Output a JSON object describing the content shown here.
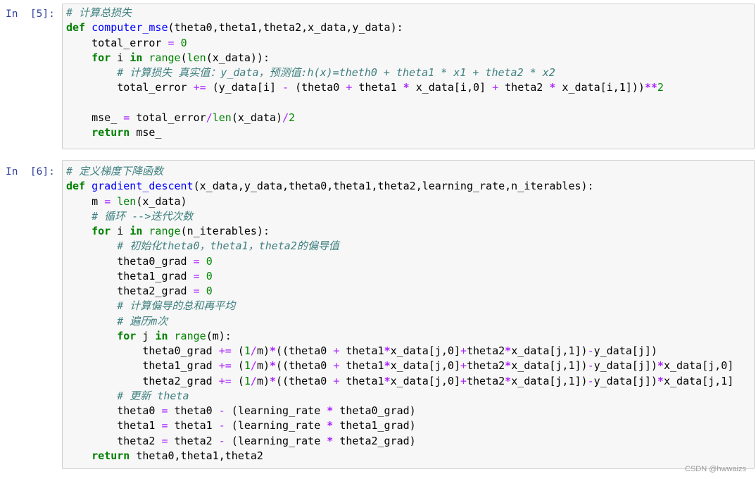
{
  "cells": [
    {
      "prompt": "In  [5]:",
      "lines": [
        [
          [
            "cm",
            "# 计算总损失"
          ]
        ],
        [
          [
            "kw",
            "def"
          ],
          [
            "t",
            " "
          ],
          [
            "fn",
            "computer_mse"
          ],
          [
            "t",
            "(theta0,theta1,theta2,x_data,y_data):"
          ]
        ],
        [
          [
            "t",
            "    total_error "
          ],
          [
            "opn",
            "="
          ],
          [
            "t",
            " "
          ],
          [
            "num",
            "0"
          ]
        ],
        [
          [
            "t",
            "    "
          ],
          [
            "kw",
            "for"
          ],
          [
            "t",
            " i "
          ],
          [
            "kw",
            "in"
          ],
          [
            "t",
            " "
          ],
          [
            "bi",
            "range"
          ],
          [
            "t",
            "("
          ],
          [
            "bi",
            "len"
          ],
          [
            "t",
            "(x_data)):"
          ]
        ],
        [
          [
            "t",
            "        "
          ],
          [
            "cm",
            "# 计算损失 真实值：y_data，预测值:h(x)=theth0 + theta1 * x1 + theta2 * x2"
          ]
        ],
        [
          [
            "t",
            "        total_error "
          ],
          [
            "opn",
            "+="
          ],
          [
            "t",
            " (y_data[i] "
          ],
          [
            "opn",
            "-"
          ],
          [
            "t",
            " (theta0 "
          ],
          [
            "opn",
            "+"
          ],
          [
            "t",
            " theta1 "
          ],
          [
            "op",
            "*"
          ],
          [
            "t",
            " x_data[i,0] "
          ],
          [
            "opn",
            "+"
          ],
          [
            "t",
            " theta2 "
          ],
          [
            "op",
            "*"
          ],
          [
            "t",
            " x_data[i,1]))"
          ],
          [
            "op",
            "**"
          ],
          [
            "num",
            "2"
          ]
        ],
        [
          [
            "t",
            ""
          ]
        ],
        [
          [
            "t",
            "    mse_ "
          ],
          [
            "opn",
            "="
          ],
          [
            "t",
            " total_error"
          ],
          [
            "opn",
            "/"
          ],
          [
            "bi",
            "len"
          ],
          [
            "t",
            "(x_data)"
          ],
          [
            "opn",
            "/"
          ],
          [
            "num",
            "2"
          ]
        ],
        [
          [
            "t",
            "    "
          ],
          [
            "kw",
            "return"
          ],
          [
            "t",
            " mse_"
          ]
        ]
      ]
    },
    {
      "prompt": "In  [6]:",
      "lines": [
        [
          [
            "cm",
            "# 定义梯度下降函数"
          ]
        ],
        [
          [
            "kw",
            "def"
          ],
          [
            "t",
            " "
          ],
          [
            "fn",
            "gradient_descent"
          ],
          [
            "t",
            "(x_data,y_data,theta0,theta1,theta2,learning_rate,n_iterables):"
          ]
        ],
        [
          [
            "t",
            "    m "
          ],
          [
            "opn",
            "="
          ],
          [
            "t",
            " "
          ],
          [
            "bi",
            "len"
          ],
          [
            "t",
            "(x_data)"
          ]
        ],
        [
          [
            "t",
            "    "
          ],
          [
            "cm",
            "# 循环 -->迭代次数"
          ]
        ],
        [
          [
            "t",
            "    "
          ],
          [
            "kw",
            "for"
          ],
          [
            "t",
            " i "
          ],
          [
            "kw",
            "in"
          ],
          [
            "t",
            " "
          ],
          [
            "bi",
            "range"
          ],
          [
            "t",
            "(n_iterables):"
          ]
        ],
        [
          [
            "t",
            "        "
          ],
          [
            "cm",
            "# 初始化theta0，theta1，theta2的偏导值"
          ]
        ],
        [
          [
            "t",
            "        theta0_grad "
          ],
          [
            "opn",
            "="
          ],
          [
            "t",
            " "
          ],
          [
            "num",
            "0"
          ]
        ],
        [
          [
            "t",
            "        theta1_grad "
          ],
          [
            "opn",
            "="
          ],
          [
            "t",
            " "
          ],
          [
            "num",
            "0"
          ]
        ],
        [
          [
            "t",
            "        theta2_grad "
          ],
          [
            "opn",
            "="
          ],
          [
            "t",
            " "
          ],
          [
            "num",
            "0"
          ]
        ],
        [
          [
            "t",
            "        "
          ],
          [
            "cm",
            "# 计算偏导的总和再平均"
          ]
        ],
        [
          [
            "t",
            "        "
          ],
          [
            "cm",
            "# 遍历m次"
          ]
        ],
        [
          [
            "t",
            "        "
          ],
          [
            "kw",
            "for"
          ],
          [
            "t",
            " j "
          ],
          [
            "kw",
            "in"
          ],
          [
            "t",
            " "
          ],
          [
            "bi",
            "range"
          ],
          [
            "t",
            "(m):"
          ]
        ],
        [
          [
            "t",
            "            theta0_grad "
          ],
          [
            "opn",
            "+="
          ],
          [
            "t",
            " ("
          ],
          [
            "num",
            "1"
          ],
          [
            "opn",
            "/"
          ],
          [
            "t",
            "m)"
          ],
          [
            "op",
            "*"
          ],
          [
            "t",
            "((theta0 "
          ],
          [
            "opn",
            "+"
          ],
          [
            "t",
            " theta1"
          ],
          [
            "op",
            "*"
          ],
          [
            "t",
            "x_data[j,0]"
          ],
          [
            "opn",
            "+"
          ],
          [
            "t",
            "theta2"
          ],
          [
            "op",
            "*"
          ],
          [
            "t",
            "x_data[j,1])"
          ],
          [
            "opn",
            "-"
          ],
          [
            "t",
            "y_data[j])"
          ]
        ],
        [
          [
            "t",
            "            theta1_grad "
          ],
          [
            "opn",
            "+="
          ],
          [
            "t",
            " ("
          ],
          [
            "num",
            "1"
          ],
          [
            "opn",
            "/"
          ],
          [
            "t",
            "m)"
          ],
          [
            "op",
            "*"
          ],
          [
            "t",
            "((theta0 "
          ],
          [
            "opn",
            "+"
          ],
          [
            "t",
            " theta1"
          ],
          [
            "op",
            "*"
          ],
          [
            "t",
            "x_data[j,0]"
          ],
          [
            "opn",
            "+"
          ],
          [
            "t",
            "theta2"
          ],
          [
            "op",
            "*"
          ],
          [
            "t",
            "x_data[j,1])"
          ],
          [
            "opn",
            "-"
          ],
          [
            "t",
            "y_data[j])"
          ],
          [
            "op",
            "*"
          ],
          [
            "t",
            "x_data[j,0]"
          ]
        ],
        [
          [
            "t",
            "            theta2_grad "
          ],
          [
            "opn",
            "+="
          ],
          [
            "t",
            " ("
          ],
          [
            "num",
            "1"
          ],
          [
            "opn",
            "/"
          ],
          [
            "t",
            "m)"
          ],
          [
            "op",
            "*"
          ],
          [
            "t",
            "((theta0 "
          ],
          [
            "opn",
            "+"
          ],
          [
            "t",
            " theta1"
          ],
          [
            "op",
            "*"
          ],
          [
            "t",
            "x_data[j,0]"
          ],
          [
            "opn",
            "+"
          ],
          [
            "t",
            "theta2"
          ],
          [
            "op",
            "*"
          ],
          [
            "t",
            "x_data[j,1])"
          ],
          [
            "opn",
            "-"
          ],
          [
            "t",
            "y_data[j])"
          ],
          [
            "op",
            "*"
          ],
          [
            "t",
            "x_data[j,1]"
          ]
        ],
        [
          [
            "t",
            "        "
          ],
          [
            "cm",
            "# 更新 theta"
          ]
        ],
        [
          [
            "t",
            "        theta0 "
          ],
          [
            "opn",
            "="
          ],
          [
            "t",
            " theta0 "
          ],
          [
            "opn",
            "-"
          ],
          [
            "t",
            " (learning_rate "
          ],
          [
            "op",
            "*"
          ],
          [
            "t",
            " theta0_grad)"
          ]
        ],
        [
          [
            "t",
            "        theta1 "
          ],
          [
            "opn",
            "="
          ],
          [
            "t",
            " theta1 "
          ],
          [
            "opn",
            "-"
          ],
          [
            "t",
            " (learning_rate "
          ],
          [
            "op",
            "*"
          ],
          [
            "t",
            " theta1_grad)"
          ]
        ],
        [
          [
            "t",
            "        theta2 "
          ],
          [
            "opn",
            "="
          ],
          [
            "t",
            " theta2 "
          ],
          [
            "opn",
            "-"
          ],
          [
            "t",
            " (learning_rate "
          ],
          [
            "op",
            "*"
          ],
          [
            "t",
            " theta2_grad)"
          ]
        ],
        [
          [
            "t",
            "    "
          ],
          [
            "kw",
            "return"
          ],
          [
            "t",
            " theta0,theta1,theta2"
          ]
        ]
      ]
    }
  ],
  "watermark": "CSDN @hwwaizs"
}
